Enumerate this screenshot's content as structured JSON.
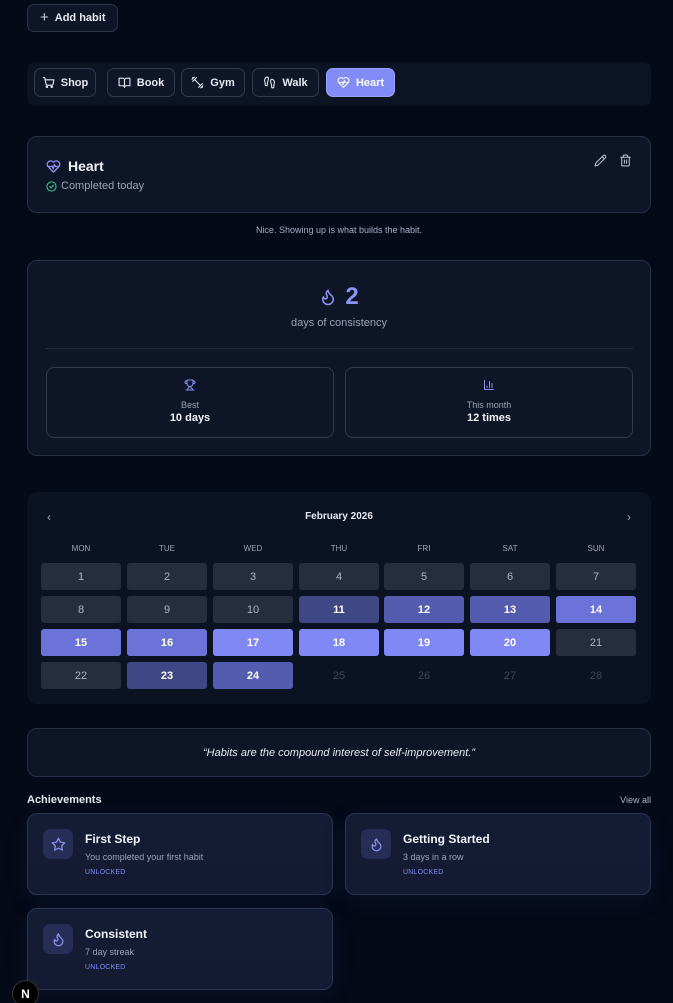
{
  "toolbar": {
    "add_habit_label": "Add habit"
  },
  "tabs": [
    {
      "label": "Shop",
      "icon": "cart-icon",
      "active": false
    },
    {
      "label": "Book",
      "icon": "book-icon",
      "active": false
    },
    {
      "label": "Gym",
      "icon": "dumbbell-icon",
      "active": false
    },
    {
      "label": "Walk",
      "icon": "footprints-icon",
      "active": false
    },
    {
      "label": "Heart",
      "icon": "heart-pulse-icon",
      "active": true
    }
  ],
  "habit": {
    "title": "Heart",
    "status": "Completed today",
    "encouragement": "Nice. Showing up is what builds the habit."
  },
  "stats": {
    "streak_value": "2",
    "streak_label": "days of consistency",
    "best_label": "Best",
    "best_value": "10 days",
    "month_label": "This month",
    "month_value": "12 times"
  },
  "calendar": {
    "title": "February 2026",
    "weekdays": [
      "MON",
      "TUE",
      "WED",
      "THU",
      "FRI",
      "SAT",
      "SUN"
    ],
    "days": [
      {
        "day": 1,
        "level": 0
      },
      {
        "day": 2,
        "level": 0
      },
      {
        "day": 3,
        "level": 0
      },
      {
        "day": 4,
        "level": 0
      },
      {
        "day": 5,
        "level": 0
      },
      {
        "day": 6,
        "level": 0
      },
      {
        "day": 7,
        "level": 0
      },
      {
        "day": 8,
        "level": 0
      },
      {
        "day": 9,
        "level": 0
      },
      {
        "day": 10,
        "level": 0
      },
      {
        "day": 11,
        "level": 1
      },
      {
        "day": 12,
        "level": 2
      },
      {
        "day": 13,
        "level": 2
      },
      {
        "day": 14,
        "level": 3
      },
      {
        "day": 15,
        "level": 3
      },
      {
        "day": 16,
        "level": 3
      },
      {
        "day": 17,
        "level": 4
      },
      {
        "day": 18,
        "level": 4
      },
      {
        "day": 19,
        "level": 4
      },
      {
        "day": 20,
        "level": 4
      },
      {
        "day": 21,
        "level": 0
      },
      {
        "day": 22,
        "level": 0
      },
      {
        "day": 23,
        "level": 1
      },
      {
        "day": 24,
        "level": 2
      },
      {
        "day": 25,
        "level": -1
      },
      {
        "day": 26,
        "level": -1
      },
      {
        "day": 27,
        "level": -1
      },
      {
        "day": 28,
        "level": -1
      }
    ]
  },
  "quote": "“Habits are the compound interest of self-improvement.”",
  "achievements": {
    "heading": "Achievements",
    "view_all": "View all",
    "items": [
      {
        "title": "First Step",
        "desc": "You completed your first habit",
        "status": "UNLOCKED",
        "icon": "star-icon"
      },
      {
        "title": "Getting Started",
        "desc": "3 days in a row",
        "status": "UNLOCKED",
        "icon": "flame-icon"
      },
      {
        "title": "Consistent",
        "desc": "7 day streak",
        "status": "UNLOCKED",
        "icon": "flame-icon"
      }
    ]
  },
  "colors": {
    "accent": "#818cf8",
    "background": "#050a18",
    "card": "#0e1526",
    "success": "#34d399"
  },
  "badge": {
    "letter": "N"
  }
}
